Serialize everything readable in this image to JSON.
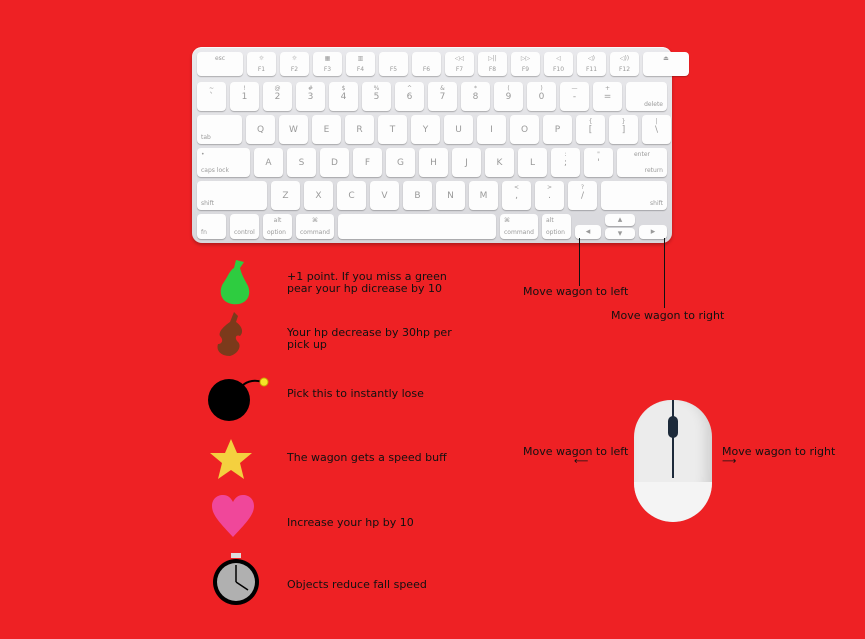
{
  "keyboard": {
    "fn_row": [
      {
        "main": "esc",
        "sub": ""
      },
      {
        "main": "☼",
        "sub": "F1"
      },
      {
        "main": "☼",
        "sub": "F2"
      },
      {
        "main": "▦",
        "sub": "F3"
      },
      {
        "main": "▥",
        "sub": "F4"
      },
      {
        "main": "",
        "sub": "F5"
      },
      {
        "main": "",
        "sub": "F6"
      },
      {
        "main": "◁◁",
        "sub": "F7"
      },
      {
        "main": "▷||",
        "sub": "F8"
      },
      {
        "main": "▷▷",
        "sub": "F9"
      },
      {
        "main": "◁",
        "sub": "F10"
      },
      {
        "main": "◁)",
        "sub": "F11"
      },
      {
        "main": "◁))",
        "sub": "F12"
      },
      {
        "main": "⏏",
        "sub": ""
      }
    ],
    "num_row": [
      {
        "top": "~",
        "bot": "`"
      },
      {
        "top": "!",
        "bot": "1"
      },
      {
        "top": "@",
        "bot": "2"
      },
      {
        "top": "#",
        "bot": "3"
      },
      {
        "top": "$",
        "bot": "4"
      },
      {
        "top": "%",
        "bot": "5"
      },
      {
        "top": "^",
        "bot": "6"
      },
      {
        "top": "&",
        "bot": "7"
      },
      {
        "top": "*",
        "bot": "8"
      },
      {
        "top": "(",
        "bot": "9"
      },
      {
        "top": ")",
        "bot": "0"
      },
      {
        "top": "—",
        "bot": "-"
      },
      {
        "top": "+",
        "bot": "="
      }
    ],
    "delete_label": "delete",
    "tab_label": "tab",
    "qwerty_row": [
      "Q",
      "W",
      "E",
      "R",
      "T",
      "Y",
      "U",
      "I",
      "O",
      "P"
    ],
    "qwerty_extra": [
      {
        "top": "{",
        "bot": "["
      },
      {
        "top": "}",
        "bot": "]"
      },
      {
        "top": "|",
        "bot": "\\"
      }
    ],
    "caps_label": "caps lock",
    "caps_dot": "•",
    "asdf_row": [
      "A",
      "S",
      "D",
      "F",
      "G",
      "H",
      "J",
      "K",
      "L"
    ],
    "asdf_extra": [
      {
        "top": ":",
        "bot": ";"
      },
      {
        "top": "\"",
        "bot": "'"
      }
    ],
    "enter_top": "enter",
    "enter_bot": "return",
    "shift_label": "shift",
    "zxcv_row": [
      "Z",
      "X",
      "C",
      "V",
      "B",
      "N",
      "M"
    ],
    "zxcv_extra": [
      {
        "top": "<",
        "bot": ","
      },
      {
        "top": ">",
        "bot": "."
      },
      {
        "top": "?",
        "bot": "/"
      }
    ],
    "fn_label": "fn",
    "control_label": "control",
    "option_label": "option",
    "alt_label": "alt",
    "command_label": "command",
    "command_symbol": "⌘",
    "arrow_left": "◂",
    "arrow_right": "▸",
    "arrow_up": "▴",
    "arrow_down": "▾"
  },
  "legend": [
    {
      "icon": "green-pear-icon",
      "text": "+1 point. If you miss a green pear your hp dicrease by 10"
    },
    {
      "icon": "rotten-pear-icon",
      "text": "Your hp decrease by 30hp per pick up"
    },
    {
      "icon": "bomb-icon",
      "text": "Pick this to instantly lose"
    },
    {
      "icon": "star-icon",
      "text": "The wagon gets a speed buff"
    },
    {
      "icon": "heart-icon",
      "text": "Increase your hp by 10"
    },
    {
      "icon": "stopwatch-icon",
      "text": "Objects reduce fall speed"
    }
  ],
  "keyboard_annotations": {
    "left": "Move wagon to left",
    "right": "Move wagon to right"
  },
  "mouse_annotations": {
    "left": "Move wagon to left",
    "right": "Move wagon to right",
    "left_arrow": "⟵",
    "right_arrow": "⟶"
  },
  "colors": {
    "background": "#ee2124",
    "pear": "#2ecc40",
    "rotten": "#7b3a1b",
    "star": "#f4d03f",
    "heart": "#f0479a",
    "bomb": "#000000",
    "fuse": "#f5e427"
  }
}
